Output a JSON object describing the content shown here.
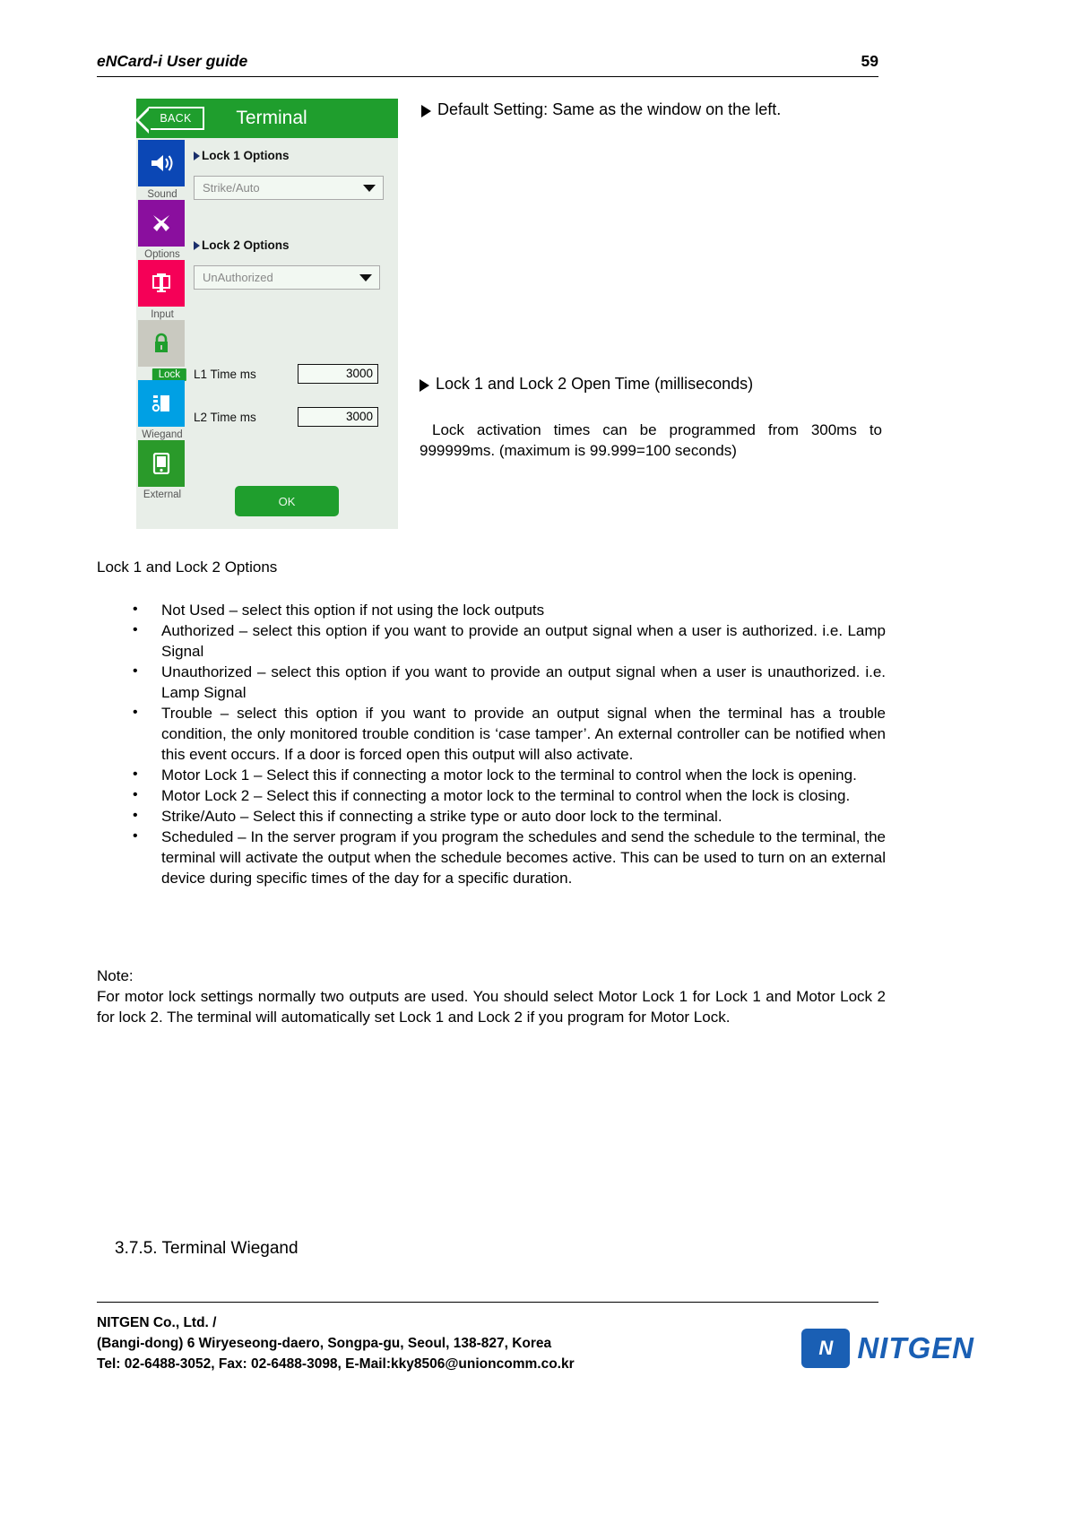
{
  "header": {
    "title": "eNCard-i User guide",
    "page_number": "59"
  },
  "terminal": {
    "back_label": "BACK",
    "title": "Terminal",
    "rail": [
      {
        "label": "Sound",
        "icon": "speaker-icon",
        "color": "#0b47b5",
        "selected": false
      },
      {
        "label": "Options",
        "icon": "tools-icon",
        "color": "#8a0f9e",
        "selected": false
      },
      {
        "label": "Input",
        "icon": "input-icon",
        "color": "#f50057",
        "selected": false
      },
      {
        "label": "Lock",
        "icon": "lock-icon",
        "color": "#c9c9c0",
        "selected": true
      },
      {
        "label": "Wiegand",
        "icon": "wiegand-icon",
        "color": "#00a0e4",
        "selected": false
      },
      {
        "label": "External",
        "icon": "external-icon",
        "color": "#2a9a2a",
        "selected": false
      }
    ],
    "lock1_label": "Lock 1 Options",
    "lock1_value": "Strike/Auto",
    "lock2_label": "Lock 2 Options",
    "lock2_value": "UnAuthorized",
    "l1_time_label": "L1 Time ms",
    "l1_time_value": "3000",
    "l2_time_label": "L2 Time ms",
    "l2_time_value": "3000",
    "ok_label": "OK"
  },
  "callouts": {
    "default_setting": "Default Setting: Same as the window on the left.",
    "open_time_heading": "Lock 1 and Lock 2 Open Time (milliseconds)",
    "open_time_body": "Lock activation times can be programmed from 300ms to 999999ms. (maximum is 99.999=100 seconds)"
  },
  "body": {
    "options_heading": "Lock 1 and Lock 2 Options",
    "bullets": [
      "Not Used – select this option if not using the lock outputs",
      "Authorized – select this option if you want to provide an output signal when a user is authorized. i.e. Lamp Signal",
      "Unauthorized – select this option if you want to provide an output signal when a user is unauthorized. i.e. Lamp Signal",
      "Trouble – select this option if you want to provide an output signal when the terminal has a trouble condition, the only monitored trouble condition is ‘case tamper’. An external controller can be notified when this event occurs. If a door is forced open this output will also activate.",
      "Motor Lock 1 – Select this if connecting a motor lock to the terminal to control when the lock is opening.",
      "Motor Lock 2 – Select this if connecting a motor lock to the terminal to control when the lock is closing.",
      "Strike/Auto – Select this if connecting a strike type or auto door lock to the terminal.",
      "Scheduled – In the server program if you program the schedules and send the schedule to the terminal, the terminal will activate the output when the schedule becomes active. This can be used to turn on an external device during specific times of the day for a specific duration."
    ],
    "note_label": "Note:",
    "note_text": "For motor lock settings normally two outputs are used. You should select Motor Lock 1 for Lock 1 and Motor Lock 2 for lock 2. The terminal will automatically set Lock 1 and Lock 2 if you program for Motor Lock.",
    "section_heading": "3.7.5. Terminal Wiegand"
  },
  "footer": {
    "line1": "NITGEN Co., Ltd. /",
    "line2": "(Bangi-dong) 6 Wiryeseong-daero, Songpa-gu, Seoul, 138-827, Korea",
    "line3": "Tel: 02-6488-3052, Fax: 02-6488-3098, E-Mail:kky8506@unioncomm.co.kr",
    "logo_text": "NITGEN",
    "logo_mark": "N"
  }
}
